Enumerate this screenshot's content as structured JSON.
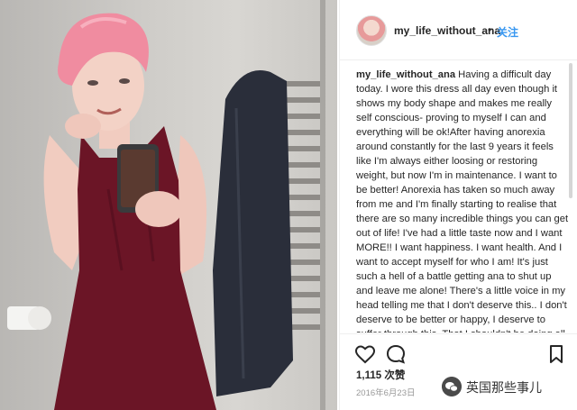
{
  "post": {
    "username": "my_life_without_ana",
    "separator": "•",
    "follow_label": "关注",
    "caption_user": "my_life_without_ana",
    "caption_text": " Having a difficult day today. I wore this dress all day even though it shows my body shape and makes me really self conscious- proving to myself I can and everything will be ok!After having anorexia around constantly for the last 9 years it feels like I'm always either loosing or restoring weight, but now I'm in maintenance. I want to be better! Anorexia has taken so much away from me and I'm finally starting to realise that there are so many incredible things you can get out of life! I've had a little taste now and I want MORE!! I want happiness. I want health. And I want to accept myself for who I am! It's just such a hell of a battle getting ana to shut up and leave me alone! There's a little voice in my head telling me that I don't deserve this.. I don't deserve to be better or happy, I deserve to suffer through this. That I shouldn't be doing all the",
    "likes": "1,115 次赞",
    "date": "2016年6月23日"
  },
  "icons": {
    "like": "heart-icon",
    "comment": "comment-icon",
    "save": "bookmark-icon",
    "watermark": "wechat-icon"
  },
  "watermark": {
    "text": "英国那些事儿"
  },
  "colors": {
    "link": "#3897f0",
    "text": "#262626",
    "muted": "#999999",
    "hair": "#f08ca0",
    "dress": "#6b1526"
  }
}
